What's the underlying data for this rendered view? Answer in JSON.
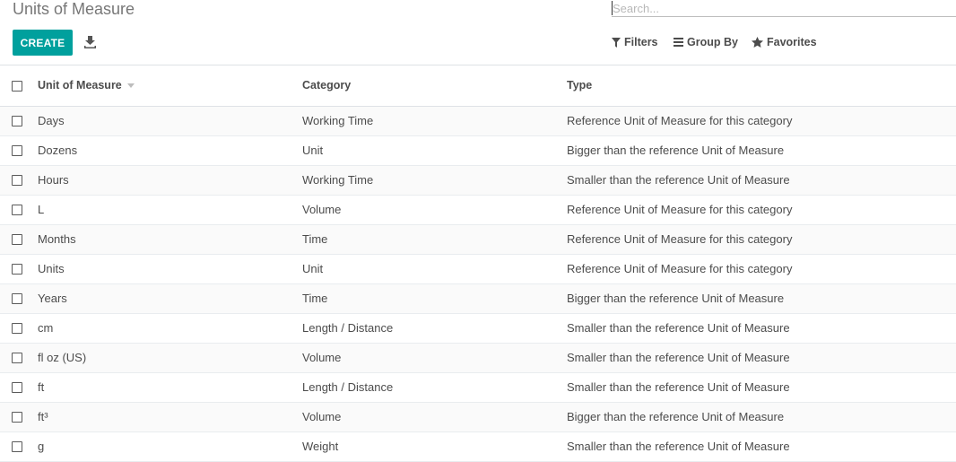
{
  "page": {
    "title": "Units of Measure"
  },
  "search": {
    "placeholder": "Search..."
  },
  "toolbar": {
    "create_label": "CREATE",
    "download_icon": "download-icon",
    "filters_label": "Filters",
    "group_by_label": "Group By",
    "favorites_label": "Favorites"
  },
  "colors": {
    "accent": "#00a09d"
  },
  "table": {
    "columns": [
      "Unit of Measure",
      "Category",
      "Type"
    ],
    "rows": [
      {
        "name": "Days",
        "category": "Working Time",
        "type": "Reference Unit of Measure for this category"
      },
      {
        "name": "Dozens",
        "category": "Unit",
        "type": "Bigger than the reference Unit of Measure"
      },
      {
        "name": "Hours",
        "category": "Working Time",
        "type": "Smaller than the reference Unit of Measure"
      },
      {
        "name": "L",
        "category": "Volume",
        "type": "Reference Unit of Measure for this category"
      },
      {
        "name": "Months",
        "category": "Time",
        "type": "Reference Unit of Measure for this category"
      },
      {
        "name": "Units",
        "category": "Unit",
        "type": "Reference Unit of Measure for this category"
      },
      {
        "name": "Years",
        "category": "Time",
        "type": "Bigger than the reference Unit of Measure"
      },
      {
        "name": "cm",
        "category": "Length / Distance",
        "type": "Smaller than the reference Unit of Measure"
      },
      {
        "name": "fl oz (US)",
        "category": "Volume",
        "type": "Smaller than the reference Unit of Measure"
      },
      {
        "name": "ft",
        "category": "Length / Distance",
        "type": "Smaller than the reference Unit of Measure"
      },
      {
        "name": "ft³",
        "category": "Volume",
        "type": "Bigger than the reference Unit of Measure"
      },
      {
        "name": "g",
        "category": "Weight",
        "type": "Smaller than the reference Unit of Measure"
      }
    ]
  }
}
